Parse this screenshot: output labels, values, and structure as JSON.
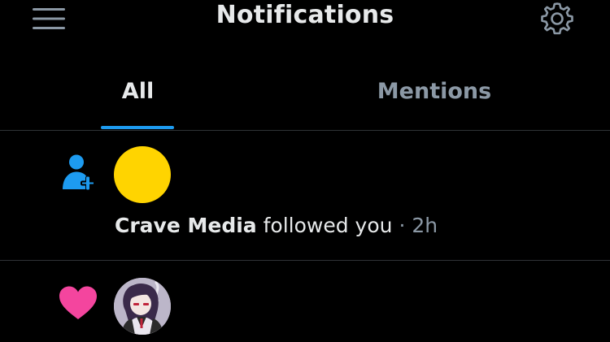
{
  "header": {
    "title": "Notifications",
    "menu_icon": "hamburger-menu-icon",
    "settings_icon": "gear-icon"
  },
  "tabs": [
    {
      "label": "All",
      "selected": true
    },
    {
      "label": "Mentions",
      "selected": false
    }
  ],
  "notifications": [
    {
      "type": "follow",
      "type_icon": "person-add-icon",
      "avatar_color": "#ffd400",
      "name": "Crave Media",
      "action": "followed you",
      "separator": "·",
      "time": "2h"
    },
    {
      "type": "like",
      "type_icon": "heart-icon",
      "avatar": "anime-character-avatar"
    }
  ],
  "colors": {
    "background": "#000000",
    "accent": "#1d9bf0",
    "like": "#f4459e",
    "avatar_yellow": "#ffd400",
    "text_primary": "#e7e9ea",
    "text_secondary": "#8b98a5",
    "divider": "#2f3336"
  }
}
